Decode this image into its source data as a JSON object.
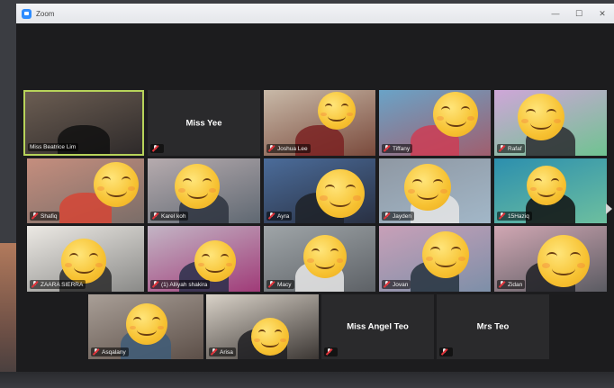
{
  "window": {
    "title": "Zoom",
    "controls": [
      "—",
      "☐",
      "✕"
    ]
  },
  "participants": [
    {
      "name": "Miss Beatrice Lim",
      "video": true,
      "active": true
    },
    {
      "name": "Miss Yee",
      "video": false
    },
    {
      "name": "Joshua Lee",
      "video": true
    },
    {
      "name": "Tiffany",
      "video": true
    },
    {
      "name": "Rafaf",
      "video": true
    },
    {
      "name": "Shafiq",
      "video": true
    },
    {
      "name": "Karel koh",
      "video": true
    },
    {
      "name": "Ayra",
      "video": true
    },
    {
      "name": "Jayden",
      "video": true
    },
    {
      "name": "15Haziq",
      "video": true
    },
    {
      "name": "ZAARA SIERRA",
      "video": true
    },
    {
      "name": "(1) Alliyah shakira",
      "video": true
    },
    {
      "name": "Macy",
      "video": true
    },
    {
      "name": "Jovan",
      "video": true
    },
    {
      "name": "Zidan",
      "video": true
    },
    {
      "name": "Asqalany",
      "video": true
    },
    {
      "name": "Arisa",
      "video": true
    },
    {
      "name": "Miss Angel Teo",
      "video": false
    },
    {
      "name": "Mrs Teo",
      "video": false
    }
  ],
  "colors": {
    "active_border": "#b7d35a",
    "gallery_bg": "#1c1c1e",
    "tile_bg": "#2a2a2c",
    "muted_mic": "#e0333a"
  },
  "icons": {
    "muted_mic": "mic-muted-icon",
    "emoji_cover": "smiling-face-icon",
    "next_page": "chevron-right-icon"
  }
}
